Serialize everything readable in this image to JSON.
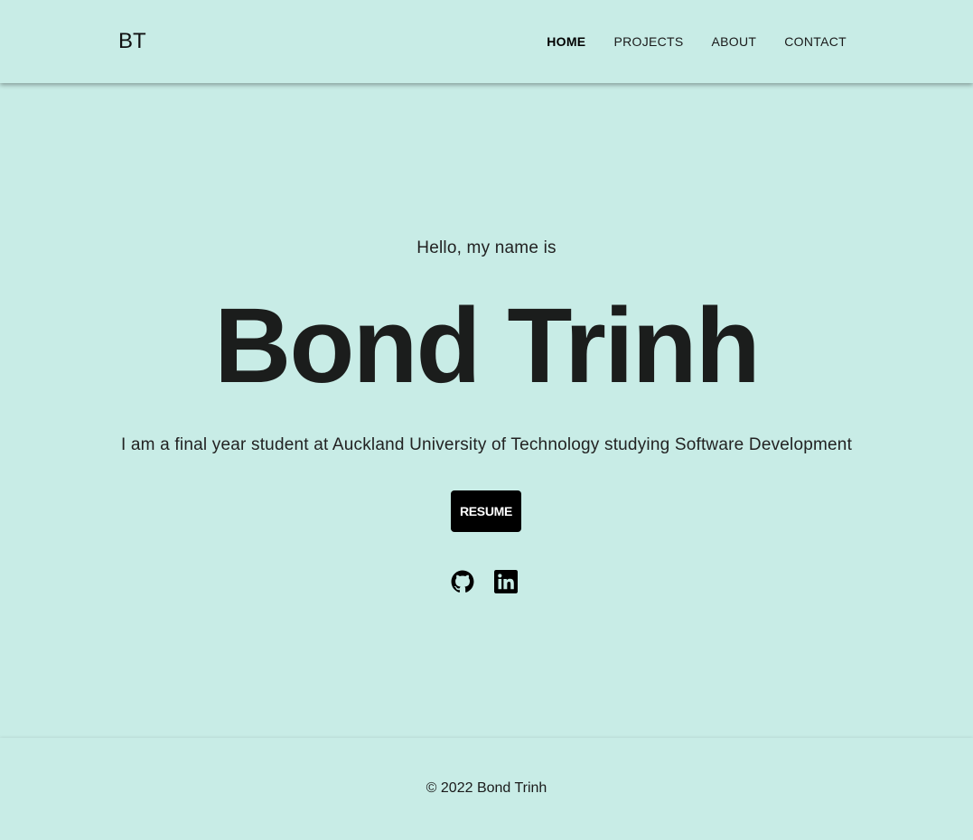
{
  "navbar": {
    "brand": "BT",
    "links": [
      {
        "label": "HOME",
        "active": true
      },
      {
        "label": "PROJECTS",
        "active": false
      },
      {
        "label": "ABOUT",
        "active": false
      },
      {
        "label": "CONTACT",
        "active": false
      }
    ]
  },
  "hero": {
    "greeting": "Hello, my name is",
    "name": "Bond Trinh",
    "tagline": "I am a final year student at Auckland University of Technology studying Software Development",
    "resume_label": "RESUME",
    "social": [
      {
        "icon": "github-icon"
      },
      {
        "icon": "linkedin-icon"
      }
    ]
  },
  "footer": {
    "copyright": "© 2022 Bond Trinh"
  },
  "colors": {
    "background": "#c8ece6",
    "text": "#1c1f1e",
    "button": "#000000"
  }
}
